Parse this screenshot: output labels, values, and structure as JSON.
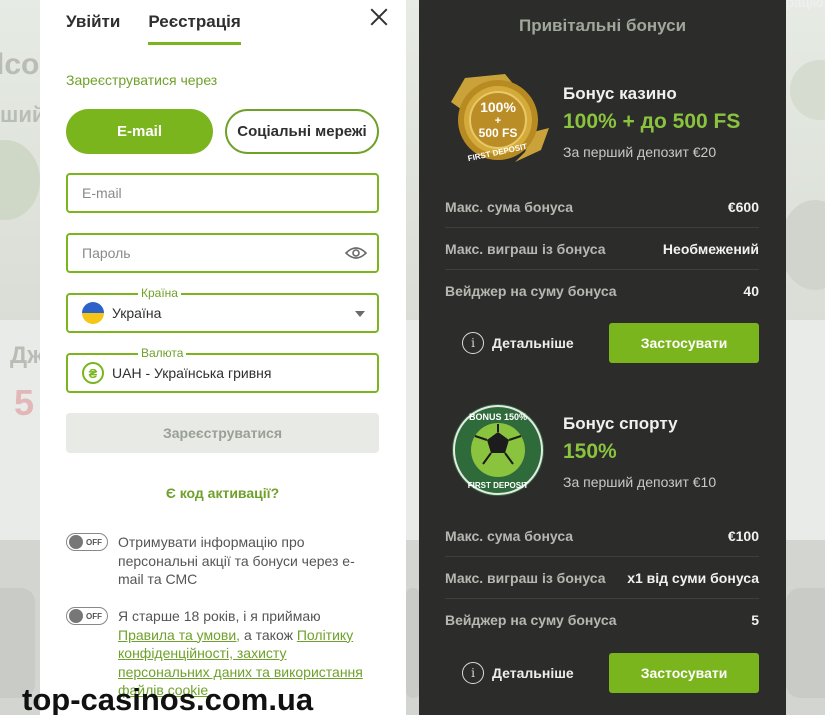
{
  "background": {
    "ghost_top": "lco",
    "ghost_left": "ший",
    "ghost_dz": "Дж",
    "ghost_num": "5",
    "ghost_corner": "рацію"
  },
  "registration": {
    "tabs": [
      {
        "label": "Увійти",
        "active": false
      },
      {
        "label": "Реєстрація",
        "active": true
      }
    ],
    "via_label": "Зареєструватися через",
    "method_email": "E-mail",
    "method_social": "Соціальні мережі",
    "email_placeholder": "E-mail",
    "password_placeholder": "Пароль",
    "country_label": "Країна",
    "country_value": "Україна",
    "currency_label": "Валюта",
    "currency_value": "UAH - Українська гривня",
    "currency_symbol": "₴",
    "submit_label": "Зареєструватися",
    "activation_label": "Є код активації?",
    "toggle_text": "OFF",
    "consent_marketing": "Отримувати інформацію про персональні акції та бонуси через e-mail та СМС",
    "consent_age_prefix": "Я старше 18 років, і я приймаю ",
    "consent_age_link1": "Правила та умови,",
    "consent_age_mid": " а також ",
    "consent_age_link2": "Політику конфіденційності, захисту персональних даних та використання файлів cookie"
  },
  "watermark": "top-casinos.com.ua",
  "bonuses": {
    "title": "Привітальні бонуси",
    "cards": [
      {
        "name": "Бонус казино",
        "amount": "100% + до 500 FS",
        "note": "За перший депозит €20",
        "badge_line1": "100%",
        "badge_line2": "+",
        "badge_line3": "500 FS",
        "badge_arc": "FIRST DEPOSIT",
        "rows": [
          {
            "key": "Макс. сума бонуса",
            "value": "€600"
          },
          {
            "key": "Макс. виграш із бонуса",
            "value": "Необмежений"
          },
          {
            "key": "Вейджер на суму бонуса",
            "value": "40"
          }
        ],
        "details_label": "Детальніше",
        "apply_label": "Застосувати"
      },
      {
        "name": "Бонус спорту",
        "amount": "150%",
        "note": "За перший депозит €10",
        "badge_arc_top": "BONUS 150%",
        "badge_arc_bottom": "FIRST DEPOSIT",
        "rows": [
          {
            "key": "Макс. сума бонуса",
            "value": "€100"
          },
          {
            "key": "Макс. виграш із бонуса",
            "value": "x1 від суми бонуса"
          },
          {
            "key": "Вейджер на суму бонуса",
            "value": "5"
          }
        ],
        "details_label": "Детальніше",
        "apply_label": "Застосувати"
      }
    ]
  },
  "colors": {
    "accent": "#7ab51d",
    "accent_text": "#6fa12a",
    "dark_panel": "#2c2c2a",
    "bonus_amount": "#8ac43f"
  }
}
